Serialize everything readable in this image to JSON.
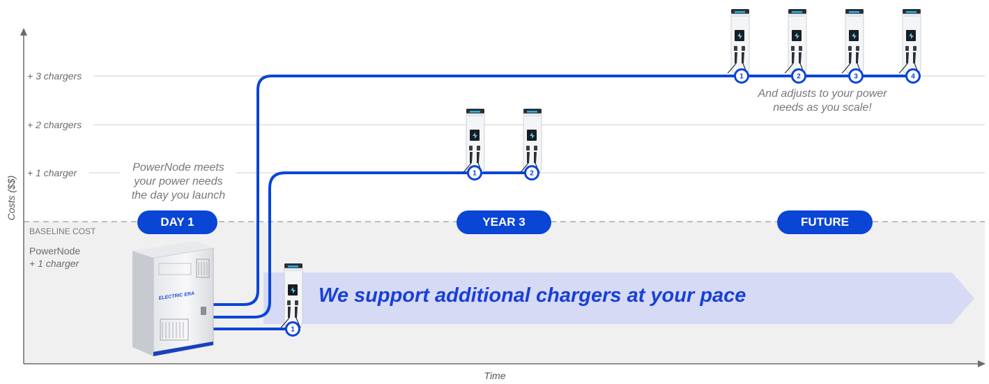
{
  "axis": {
    "y_label": "Costs ($$)",
    "x_label": "Time"
  },
  "levels": {
    "three": "+ 3 chargers",
    "two": "+ 2 chargers",
    "one": "+ 1 charger",
    "baseline": "BASELINE COST",
    "powernode": "PowerNode",
    "plus_one": "+ 1 charger"
  },
  "phases": {
    "day1": "DAY 1",
    "year3": "YEAR 3",
    "future": "FUTURE"
  },
  "notes": {
    "launch": [
      "PowerNode meets",
      "your power needs",
      "the day you launch"
    ],
    "scale": [
      "And adjusts to your power",
      "needs as you scale!"
    ]
  },
  "banner": "We support additional chargers at your pace",
  "cabinet_brand": "ELECTRIC ERA",
  "badges": {
    "day1": [
      "1"
    ],
    "year3": [
      "1",
      "2"
    ],
    "future": [
      "1",
      "2",
      "3",
      "4"
    ]
  },
  "colors": {
    "accent": "#0a45d6",
    "banner_fill": "#d6daf5",
    "baseline_fill": "#f0f0f0"
  }
}
